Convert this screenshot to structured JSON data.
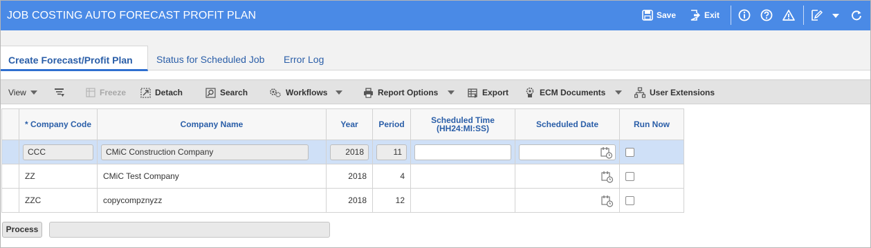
{
  "header": {
    "title": "JOB COSTING AUTO FORECAST PROFIT PLAN",
    "save_label": "Save",
    "exit_label": "Exit",
    "bg_color": "#4a8ae6"
  },
  "tabs": [
    {
      "label": "Create Forecast/Profit Plan",
      "active": true
    },
    {
      "label": "Status for Scheduled Job",
      "active": false
    },
    {
      "label": "Error Log",
      "active": false
    }
  ],
  "toolbar": {
    "view": "View",
    "freeze": "Freeze",
    "detach": "Detach",
    "search": "Search",
    "workflows": "Workflows",
    "report_options": "Report Options",
    "export": "Export",
    "ecm_documents": "ECM Documents",
    "user_extensions": "User Extensions"
  },
  "grid": {
    "columns": [
      "* Company Code",
      "Company Name",
      "Year",
      "Period",
      "Scheduled Time (HH24:MI:SS)",
      "Scheduled Date",
      "Run Now"
    ],
    "scheduled_time_line1": "Scheduled Time",
    "scheduled_time_line2": "(HH24:MI:SS)",
    "rows": [
      {
        "company_code": "CCC",
        "company_name": "CMiC Construction Company",
        "year": "2018",
        "period": "11",
        "scheduled_time": "",
        "scheduled_date": "",
        "run_now": false,
        "selected": true
      },
      {
        "company_code": "ZZ",
        "company_name": "CMiC Test Company",
        "year": "2018",
        "period": "4",
        "scheduled_time": "",
        "scheduled_date": "",
        "run_now": false,
        "selected": false
      },
      {
        "company_code": "ZZC",
        "company_name": "copycompznyzz",
        "year": "2018",
        "period": "12",
        "scheduled_time": "",
        "scheduled_date": "",
        "run_now": false,
        "selected": false
      }
    ]
  },
  "footer": {
    "process_label": "Process",
    "progress": 0
  }
}
